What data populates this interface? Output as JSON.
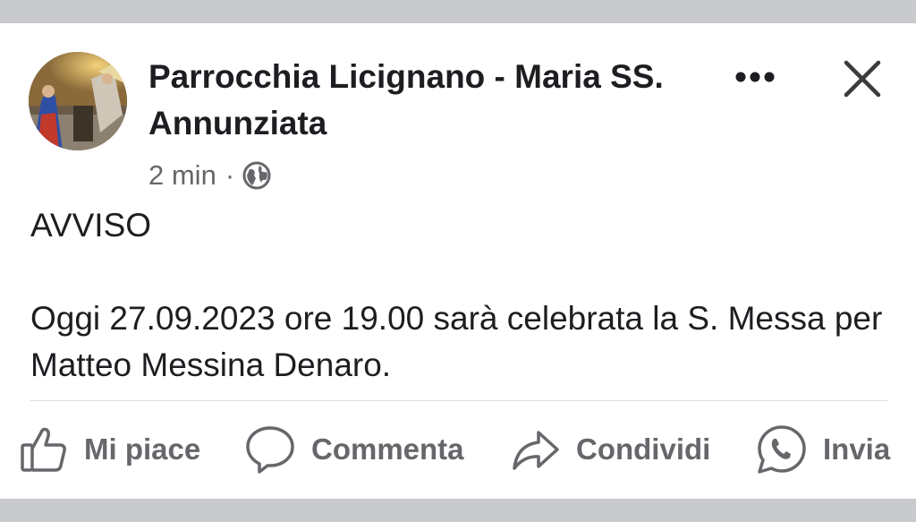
{
  "post": {
    "page_name": "Parrocchia Licignano - Maria SS. Annunziata",
    "time": "2 min",
    "separator": "·",
    "audience_icon": "globe-icon",
    "body_heading": "AVVISO",
    "body_text": "Oggi 27.09.2023 ore 19.00 sarà celebrata la S. Messa per Matteo Messina Denaro."
  },
  "header_actions": {
    "more_icon": "more-horizontal-icon",
    "close_icon": "close-icon"
  },
  "actions": {
    "like_label": "Mi piace",
    "comment_label": "Commenta",
    "share_label": "Condividi",
    "send_label": "Invia"
  },
  "colors": {
    "text_primary": "#1c1e21",
    "text_secondary": "#65676b",
    "divider": "#dadde1",
    "frame_bar": "#c9cacd"
  }
}
